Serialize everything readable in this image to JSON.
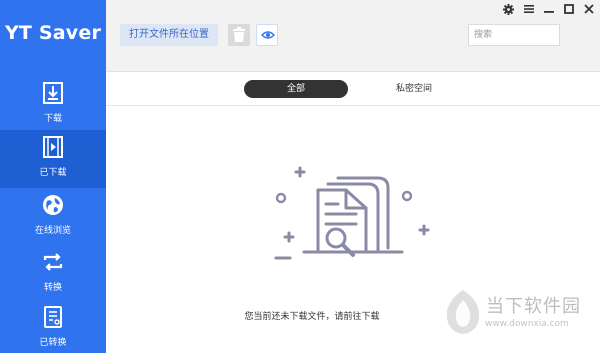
{
  "app": {
    "title": "YT Saver"
  },
  "sidebar": {
    "items": [
      {
        "label": "下载",
        "icon": "download-icon"
      },
      {
        "label": "已下载",
        "icon": "film-icon",
        "active": true
      },
      {
        "label": "在线浏览",
        "icon": "globe-icon"
      },
      {
        "label": "转换",
        "icon": "convert-icon"
      },
      {
        "label": "已转换",
        "icon": "converted-file-icon"
      }
    ]
  },
  "toolbar": {
    "open_location_label": "打开文件所在位置",
    "trash_icon": "trash-icon",
    "eye_icon": "eye-icon",
    "search_placeholder": "搜索"
  },
  "window_controls": [
    "gear-icon",
    "menu-icon",
    "minimize-icon",
    "maximize-icon",
    "close-icon"
  ],
  "tabs": [
    {
      "label": "全部",
      "active": true
    },
    {
      "label": "私密空间",
      "active": false
    }
  ],
  "empty_state": {
    "message": "您当前还未下载文件，请前往下载"
  },
  "watermark": {
    "title": "当下软件园",
    "url": "www.downxia.com"
  },
  "colors": {
    "sidebar": "#2f73ee",
    "sidebar_active": "#1e5fd4",
    "accent": "#3b67c7",
    "illustration": "#8a89a6"
  }
}
